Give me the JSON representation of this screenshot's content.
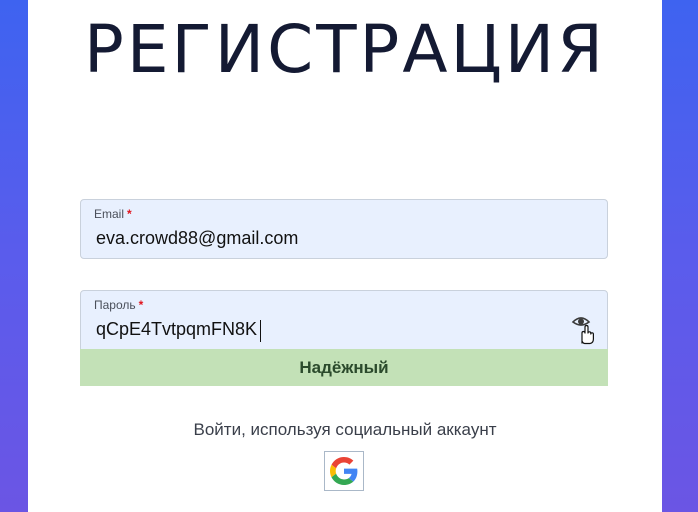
{
  "form": {
    "title": "РЕГИСТРАЦИЯ",
    "email": {
      "label": "Email",
      "required_mark": "*",
      "value": "eva.crowd88@gmail.com"
    },
    "password": {
      "label": "Пароль",
      "required_mark": "*",
      "value": "qCpE4TvtpqmFN8K",
      "toggle_icon": "eye-icon"
    },
    "strength": {
      "label": "Надёжный",
      "color": "#c3e1b7"
    },
    "social": {
      "text": "Войти, используя социальный аккаунт",
      "providers": [
        "google-icon"
      ]
    }
  },
  "colors": {
    "background_start": "#3e63f0",
    "background_end": "#6b55e4",
    "field_bg": "#e8f0fe",
    "required": "#e0141e"
  }
}
